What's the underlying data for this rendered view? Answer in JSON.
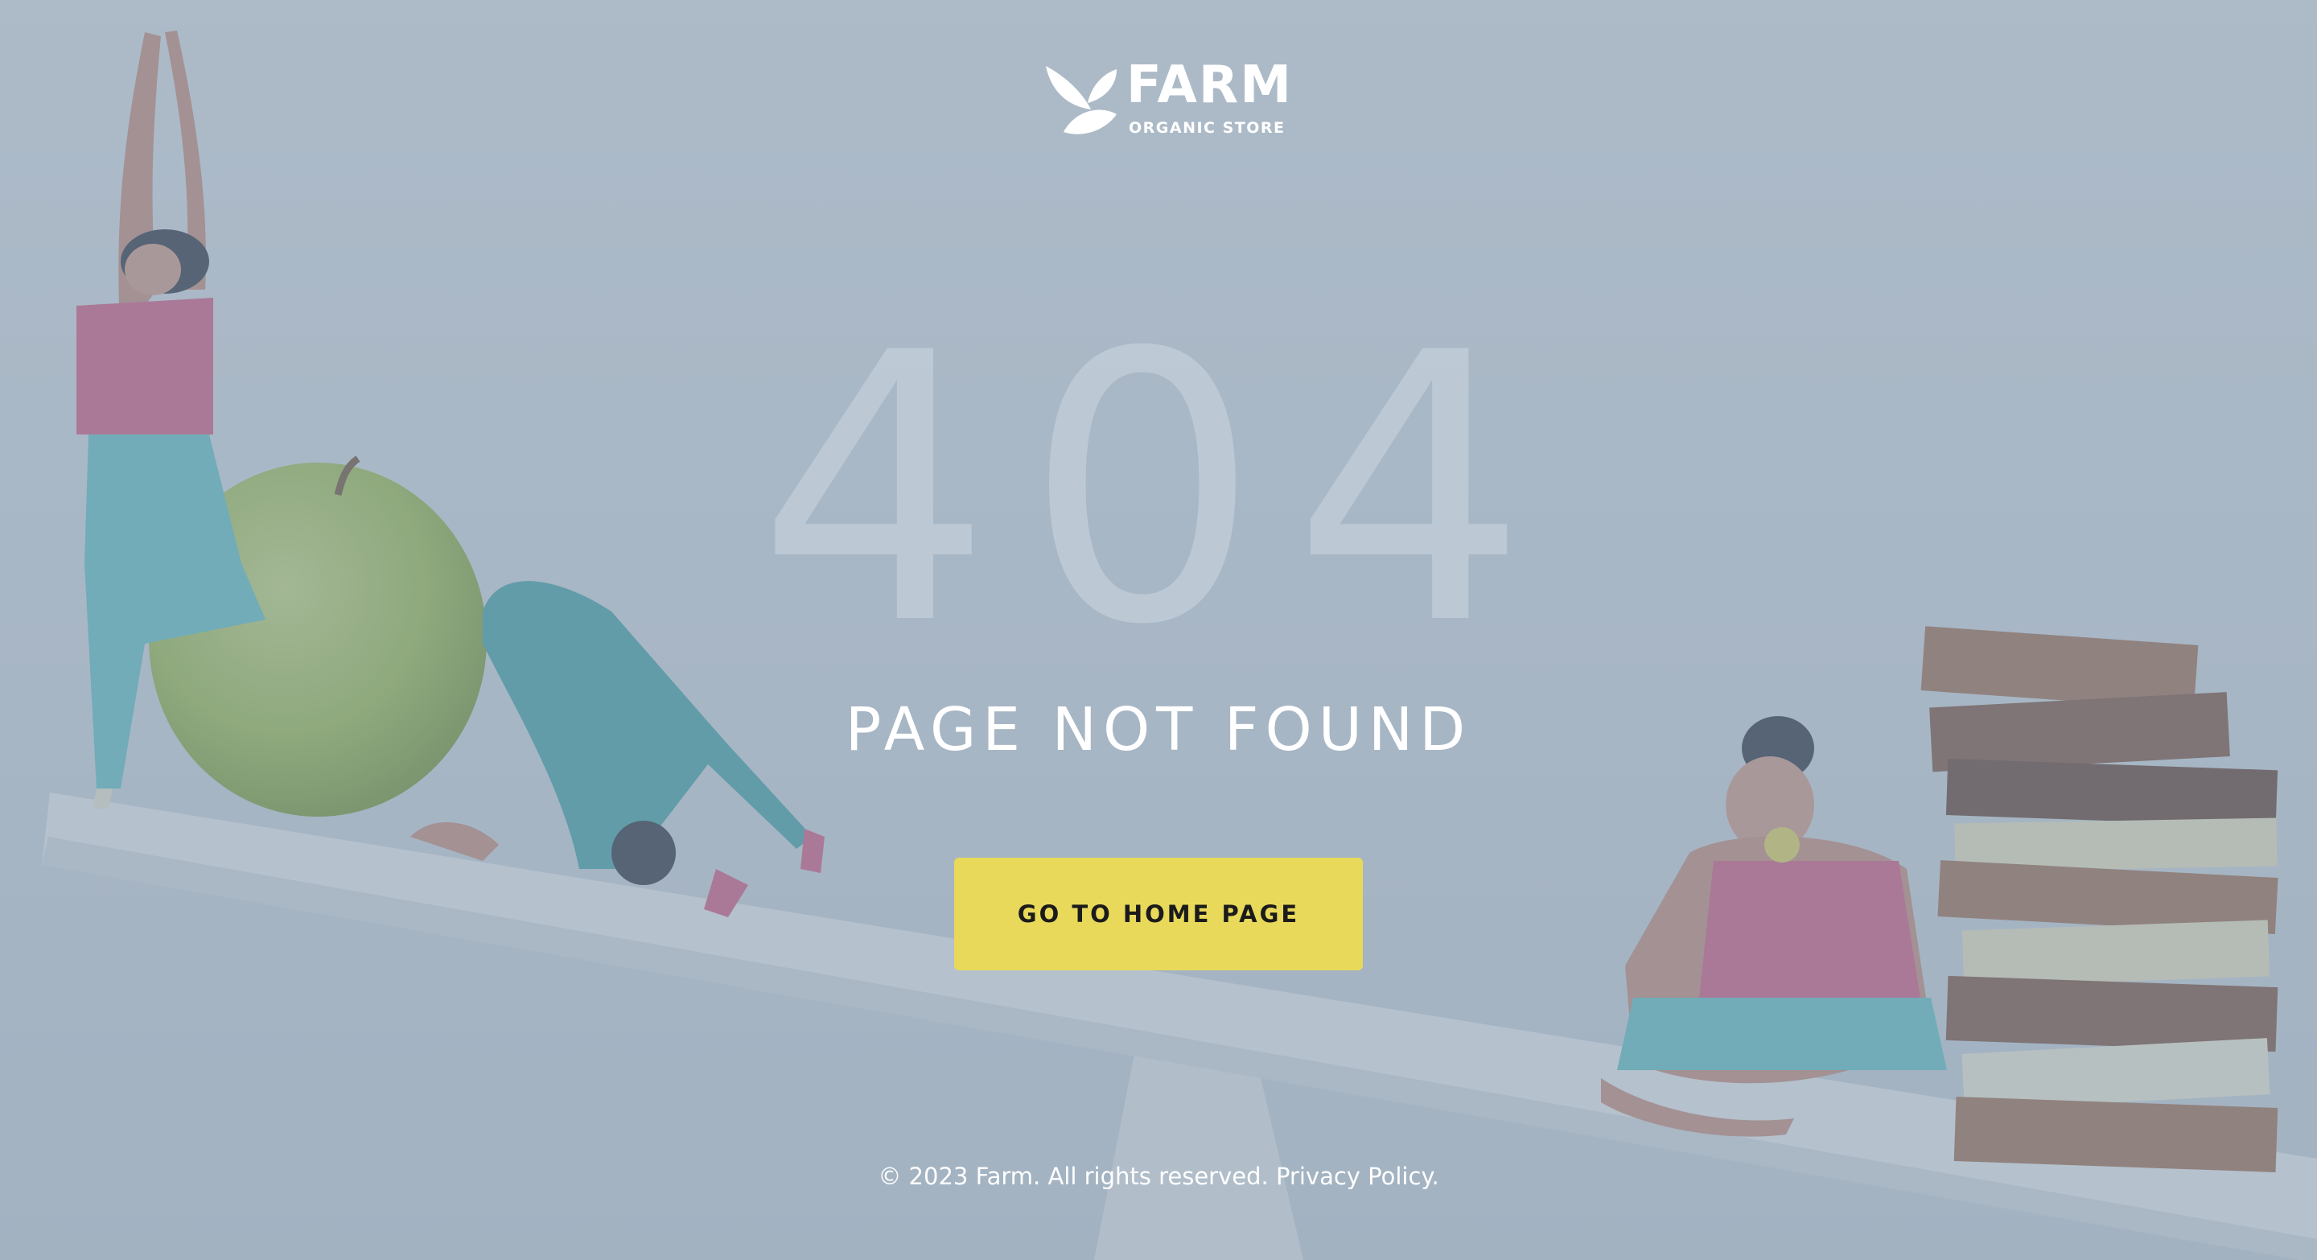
{
  "brand": {
    "name": "FARM",
    "tagline": "ORGANIC STORE"
  },
  "error": {
    "code": "404",
    "message": "PAGE NOT FOUND"
  },
  "actions": {
    "home_button_label": "GO TO HOME PAGE"
  },
  "footer": {
    "copyright_symbol": "©",
    "copyright_text": "2023 Farm.  All rights reserved.",
    "privacy_link": "Privacy Policy."
  },
  "colors": {
    "button_background": "#e8d95a",
    "overlay": "#8498ac",
    "text": "#ffffff"
  },
  "icons": {
    "logo": "leaf-logo-icon"
  }
}
